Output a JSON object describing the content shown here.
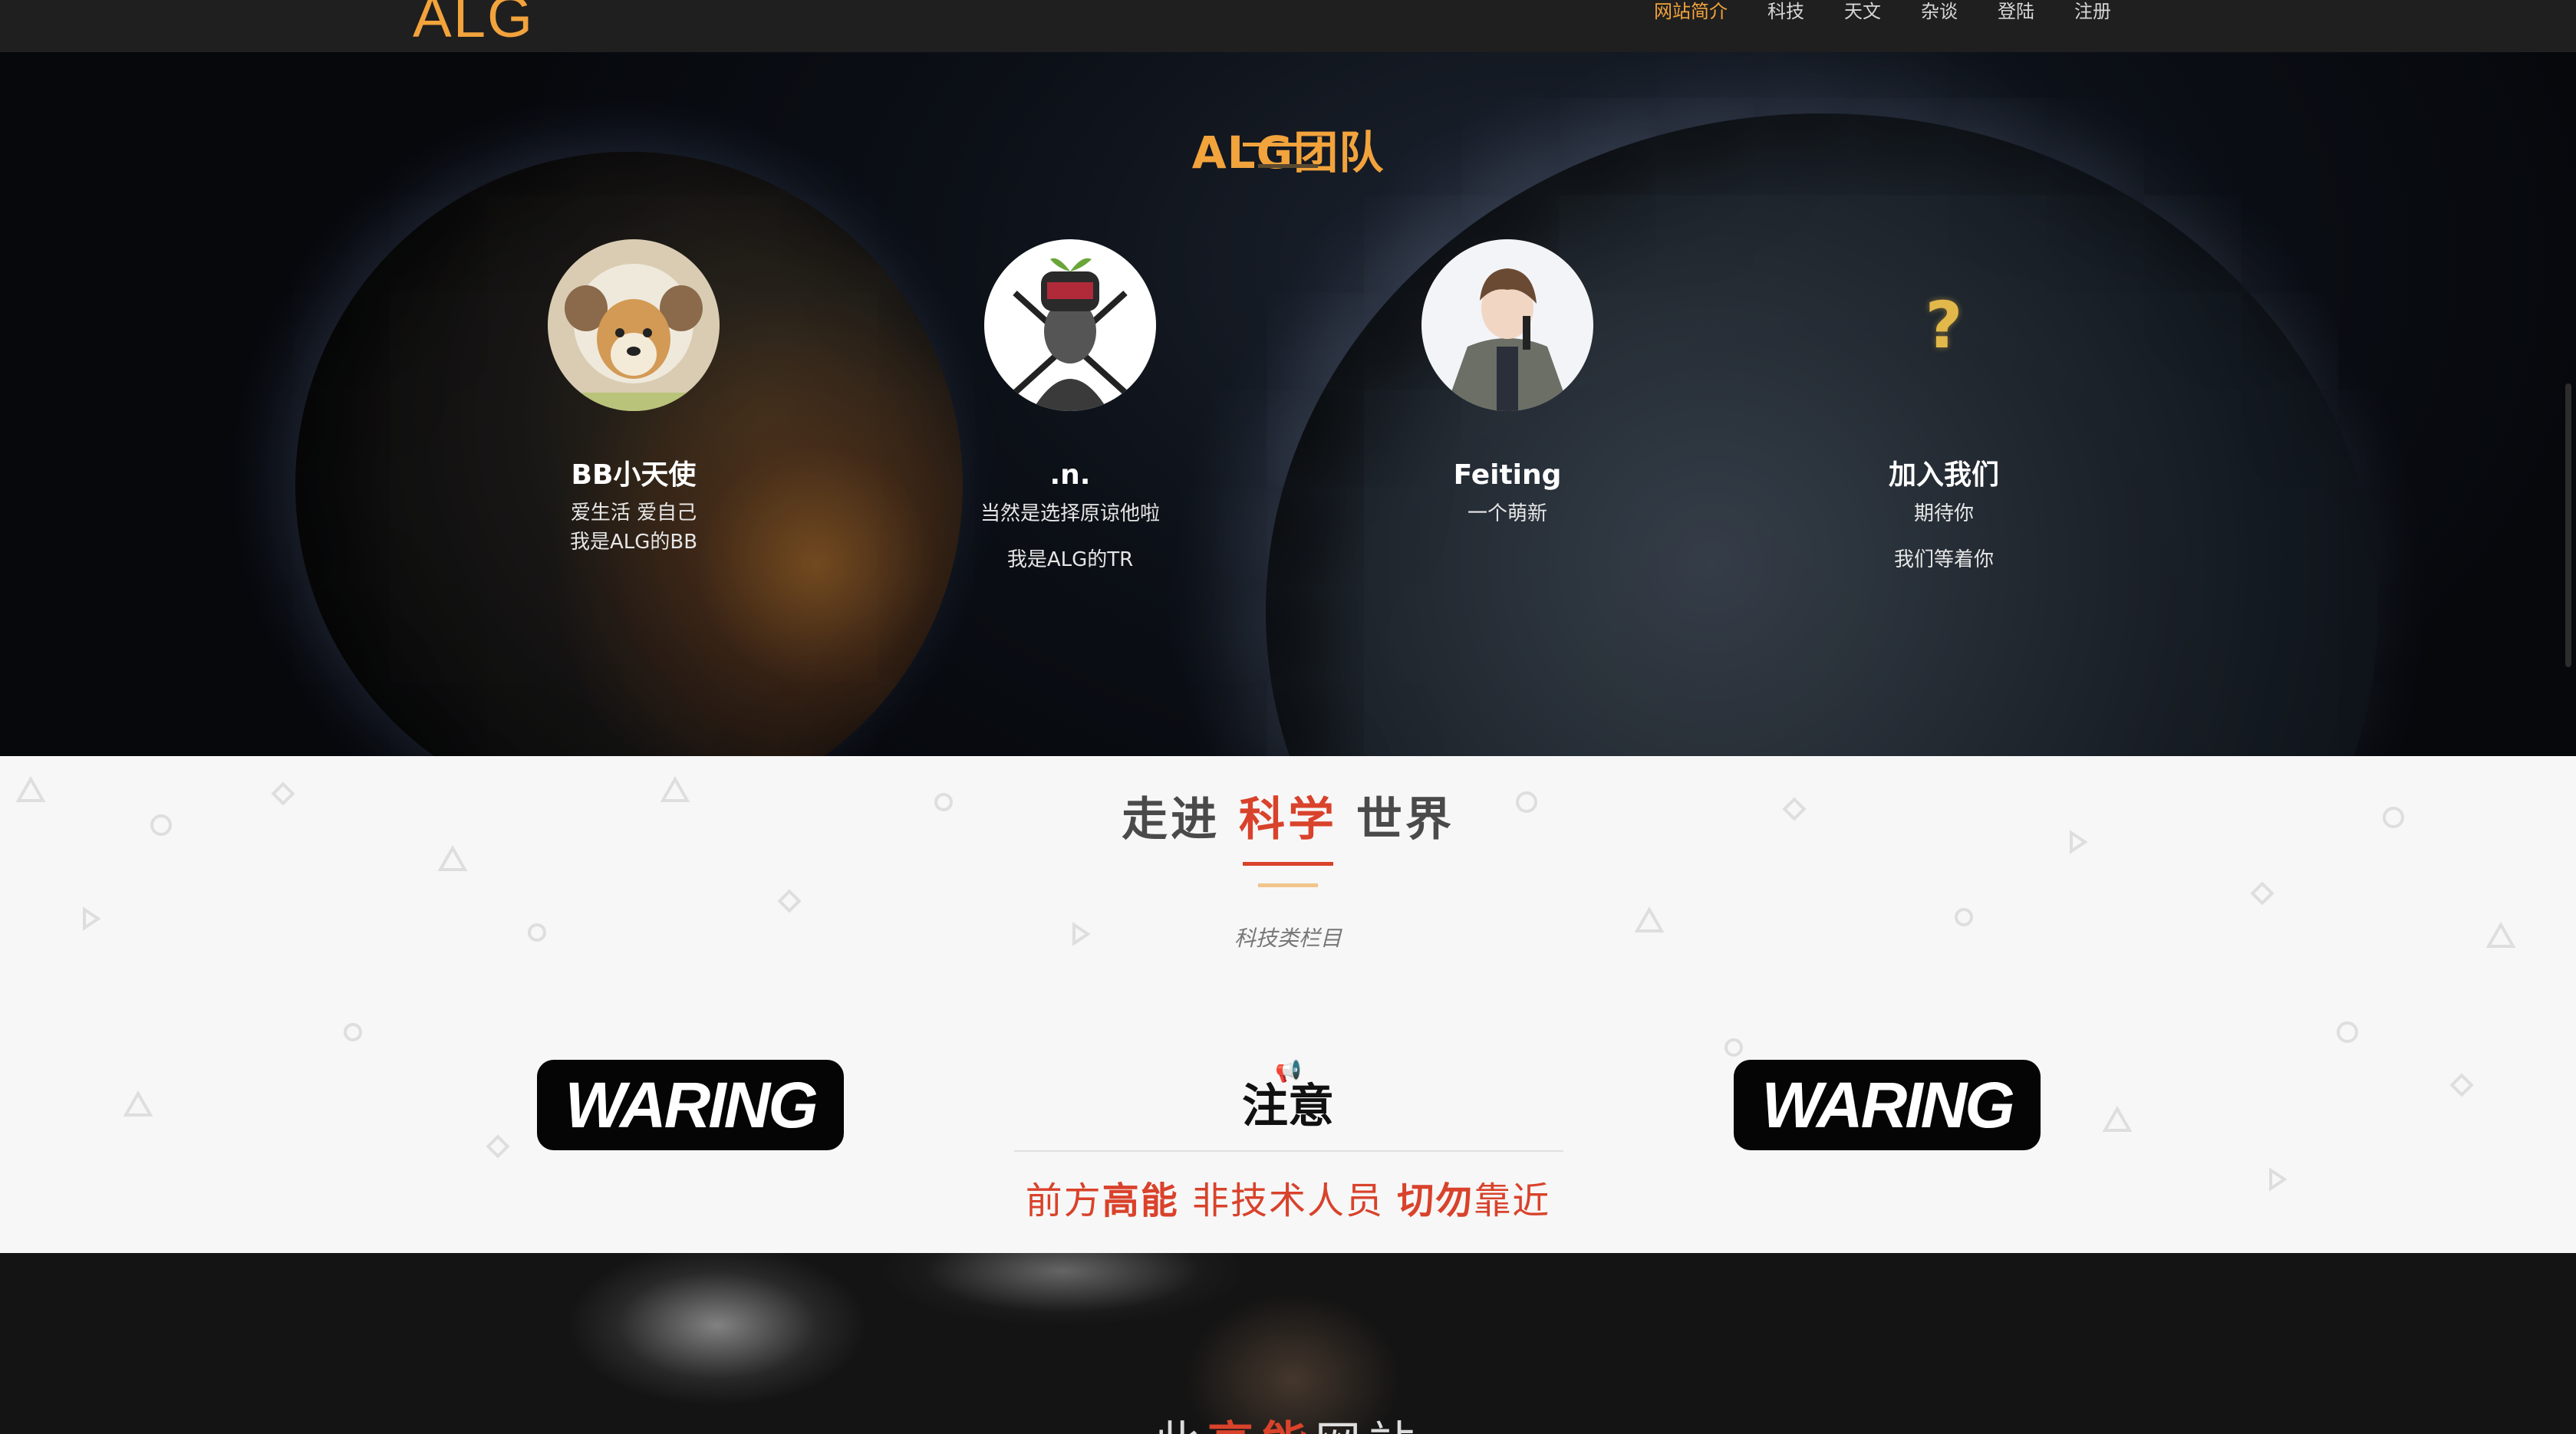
{
  "nav": {
    "logo": "ALG",
    "links": [
      "网站简介",
      "科技",
      "天文",
      "杂谈",
      "登陆",
      "注册"
    ]
  },
  "team": {
    "title": "ALG团队",
    "members": [
      {
        "name": "BB小天使",
        "desc": [
          "爱生活 爱自己",
          "我是ALG的BB"
        ]
      },
      {
        "name": ".n.",
        "desc": [
          "当然是选择原谅他啦",
          "我是ALG的TR"
        ]
      },
      {
        "name": "Feiting",
        "desc": [
          "一个萌新"
        ]
      },
      {
        "name": "加入我们",
        "desc": [
          "期待你",
          "我们等着你"
        ],
        "icon": "?"
      }
    ]
  },
  "science": {
    "title_pre": "走进",
    "title_hl": "科学",
    "title_post": "世界",
    "subtitle": "科技类栏目",
    "waring_label": "WARING",
    "notice_title": "注意",
    "notice_icon": "megaphone-icon",
    "notice_parts": [
      "前方",
      "高能",
      " 非技术人员 ",
      "切勿",
      "靠近"
    ]
  },
  "bottom": {
    "text_pre": "此",
    "text_hl": "高能",
    "text_post": "网站"
  },
  "colors": {
    "accent": "#f2a33c",
    "red": "#d9422b",
    "nav_bg": "#1f1f1f"
  }
}
